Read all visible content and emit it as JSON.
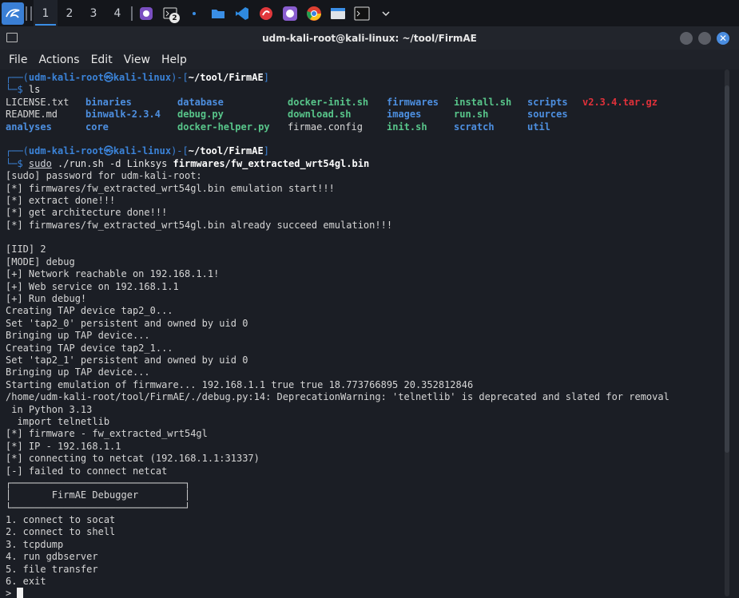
{
  "taskbar": {
    "workspaces": [
      "1",
      "2",
      "3",
      "4"
    ],
    "terminal_badge": "2",
    "icons": [
      "kali-menu-icon",
      "github-desktop-icon",
      "terminal-icon",
      "dot-icon",
      "folder-icon",
      "vscode-icon",
      "burp-icon",
      "github-icon",
      "chrome-icon",
      "files-icon",
      "terminal-small-icon",
      "chevron-down-icon"
    ]
  },
  "window": {
    "title": "udm-kali-root@kali-linux: ~/tool/FirmAE",
    "close_glyph": "✕"
  },
  "menubar": {
    "items": [
      "File",
      "Actions",
      "Edit",
      "View",
      "Help"
    ]
  },
  "terminal": {
    "prompt1": {
      "top": "┌──(",
      "user": "udm-kali-root㉿kali-linux",
      "mid": ")-[",
      "path": "~/tool/FirmAE",
      "end": "]",
      "bottom": "└─$ ",
      "cmd": "ls"
    },
    "ls_rows": [
      [
        {
          "t": "LICENSE.txt",
          "k": "plain"
        },
        {
          "t": "binaries",
          "k": "dir"
        },
        {
          "t": "database",
          "k": "dir"
        },
        {
          "t": "docker-init.sh",
          "k": "exe"
        },
        {
          "t": "firmwares",
          "k": "dir"
        },
        {
          "t": "install.sh",
          "k": "exe"
        },
        {
          "t": "scripts",
          "k": "dir"
        },
        {
          "t": "v2.3.4.tar.gz",
          "k": "red"
        }
      ],
      [
        {
          "t": "README.md",
          "k": "plain"
        },
        {
          "t": "binwalk-2.3.4",
          "k": "dir"
        },
        {
          "t": "debug.py",
          "k": "exe"
        },
        {
          "t": "download.sh",
          "k": "exe"
        },
        {
          "t": "images",
          "k": "dir"
        },
        {
          "t": "run.sh",
          "k": "exe"
        },
        {
          "t": "sources",
          "k": "dir"
        },
        {
          "t": "",
          "k": "plain"
        }
      ],
      [
        {
          "t": "analyses",
          "k": "dir"
        },
        {
          "t": "core",
          "k": "dir"
        },
        {
          "t": "docker-helper.py",
          "k": "exe"
        },
        {
          "t": "firmae.config",
          "k": "plain"
        },
        {
          "t": "init.sh",
          "k": "exe"
        },
        {
          "t": "scratch",
          "k": "dir"
        },
        {
          "t": "util",
          "k": "dir"
        },
        {
          "t": "",
          "k": "plain"
        }
      ]
    ],
    "prompt2": {
      "sudo": "sudo",
      "args": " ./run.sh -d Linksys ",
      "file": "firmwares/fw_extracted_wrt54gl.bin"
    },
    "output": [
      "[sudo] password for udm-kali-root:",
      "[*] firmwares/fw_extracted_wrt54gl.bin emulation start!!!",
      "[*] extract done!!!",
      "[*] get architecture done!!!",
      "[*] firmwares/fw_extracted_wrt54gl.bin already succeed emulation!!!",
      "",
      "[IID] 2",
      "[MODE] debug",
      "[+] Network reachable on 192.168.1.1!",
      "[+] Web service on 192.168.1.1",
      "[+] Run debug!",
      "Creating TAP device tap2_0...",
      "Set 'tap2_0' persistent and owned by uid 0",
      "Bringing up TAP device...",
      "Creating TAP device tap2_1...",
      "Set 'tap2_1' persistent and owned by uid 0",
      "Bringing up TAP device...",
      "Starting emulation of firmware... 192.168.1.1 true true 18.773766895 20.352812846",
      "/home/udm-kali-root/tool/FirmAE/./debug.py:14: DeprecationWarning: 'telnetlib' is deprecated and slated for removal",
      " in Python 3.13",
      "  import telnetlib",
      "[*] firmware - fw_extracted_wrt54gl",
      "[*] IP - 192.168.1.1",
      "[*] connecting to netcat (192.168.1.1:31337)",
      "[-] failed to connect netcat",
      "┌──────────────────────────────┐",
      "│       FirmAE Debugger        │",
      "└──────────────────────────────┘",
      "1. connect to socat",
      "2. connect to shell",
      "3. tcpdump",
      "4. run gdbserver",
      "5. file transfer",
      "6. exit",
      "> "
    ]
  },
  "colors": {
    "accent": "#3b83d8",
    "exe": "#58c58a",
    "archive": "#e0313a",
    "background": "#1b1e25"
  }
}
